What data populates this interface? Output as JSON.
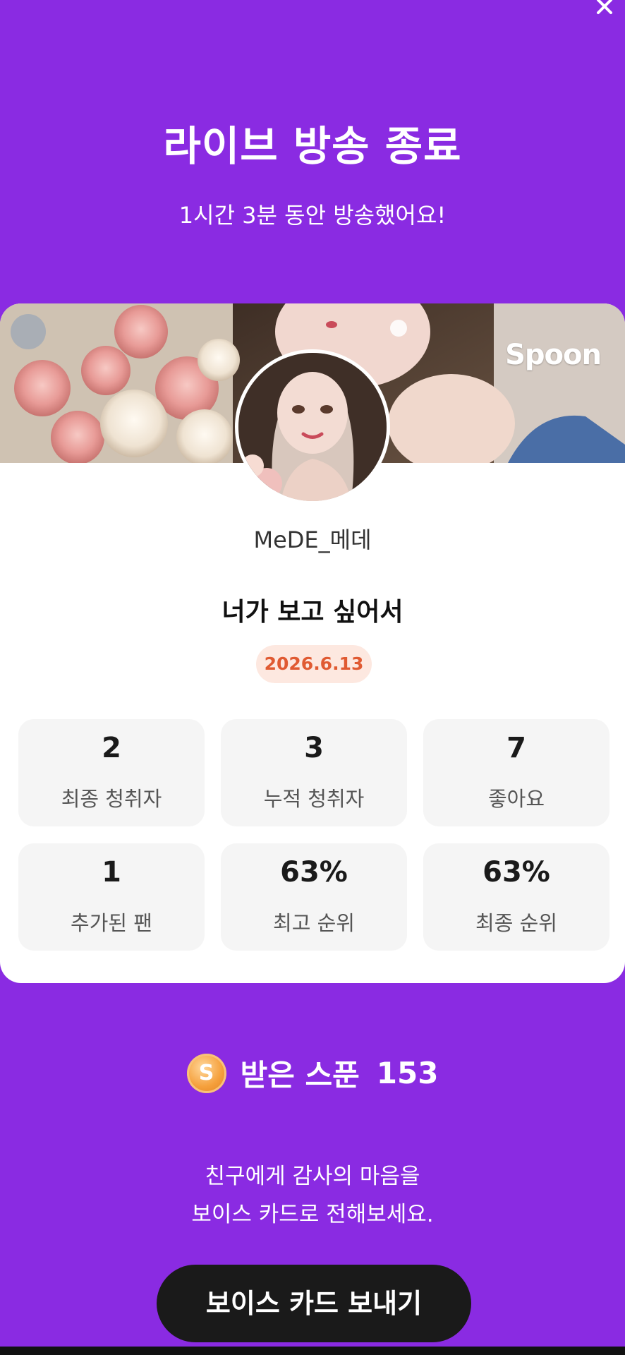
{
  "header": {
    "close_icon": "close-icon",
    "title": "라이브 방송 종료",
    "subtitle": "1시간 3분 동안 방송했어요!"
  },
  "card": {
    "brand": "Spoon",
    "username": "MeDE_메데",
    "live_title": "너가 보고 싶어서",
    "date": "2026.6.13",
    "stats": [
      {
        "value": "2",
        "label": "최종 청취자"
      },
      {
        "value": "3",
        "label": "누적 청취자"
      },
      {
        "value": "7",
        "label": "좋아요"
      },
      {
        "value": "1",
        "label": "추가된 팬"
      },
      {
        "value": "63%",
        "label": "최고 순위"
      },
      {
        "value": "63%",
        "label": "최종 순위"
      }
    ]
  },
  "spoon": {
    "coin_letter": "S",
    "label": "받은 스푼",
    "count": "153"
  },
  "thanks": {
    "line1": "친구에게 감사의 마음을",
    "line2": "보이스 카드로 전해보세요."
  },
  "action": {
    "voice_card_button": "보이스 카드 보내기"
  },
  "colors": {
    "background": "#8a2be2",
    "card": "#ffffff",
    "date_badge_bg": "#fde8e0",
    "date_badge_text": "#e05a32",
    "button_bg": "#1a1a1a"
  }
}
